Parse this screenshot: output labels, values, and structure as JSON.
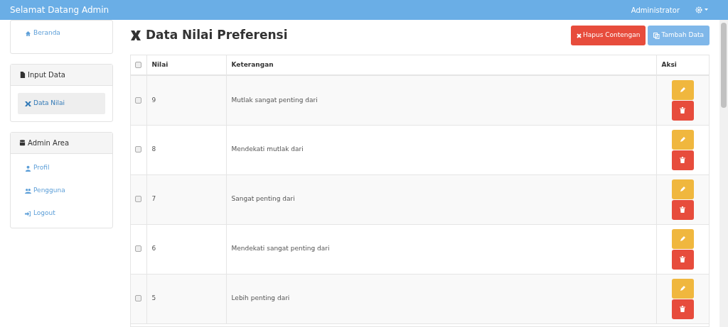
{
  "navbar": {
    "title": "Selamat Datang Admin",
    "user": "Administrator"
  },
  "sidebar": [
    {
      "items": [
        {
          "label": "Beranda",
          "selected": false
        }
      ]
    },
    {
      "title": "Input Data",
      "items": [
        {
          "label": "Data Nilai",
          "selected": true
        }
      ]
    },
    {
      "title": "Admin Area",
      "items": [
        {
          "label": "Profil",
          "selected": false
        },
        {
          "label": "Pengguna",
          "selected": false
        },
        {
          "label": "Logout",
          "selected": false
        }
      ]
    }
  ],
  "page_title": "Data Nilai Preferensi",
  "buttons": [
    {
      "label": "Hapus Contengan",
      "kind": "danger"
    },
    {
      "label": "Tambah Data",
      "kind": "primary"
    }
  ],
  "table": {
    "columns": [
      "Nilai",
      "Keterangan",
      "Aksi"
    ],
    "header_checked": false,
    "rows": [
      {
        "checked": false,
        "nilai": "9",
        "keterangan": "Mutlak sangat penting dari"
      },
      {
        "checked": false,
        "nilai": "8",
        "keterangan": "Mendekati mutlak dari"
      },
      {
        "checked": false,
        "nilai": "7",
        "keterangan": "Sangat penting dari"
      },
      {
        "checked": false,
        "nilai": "6",
        "keterangan": "Mendekati sangat penting dari"
      },
      {
        "checked": false,
        "nilai": "5",
        "keterangan": "Lebih penting dari"
      }
    ]
  }
}
